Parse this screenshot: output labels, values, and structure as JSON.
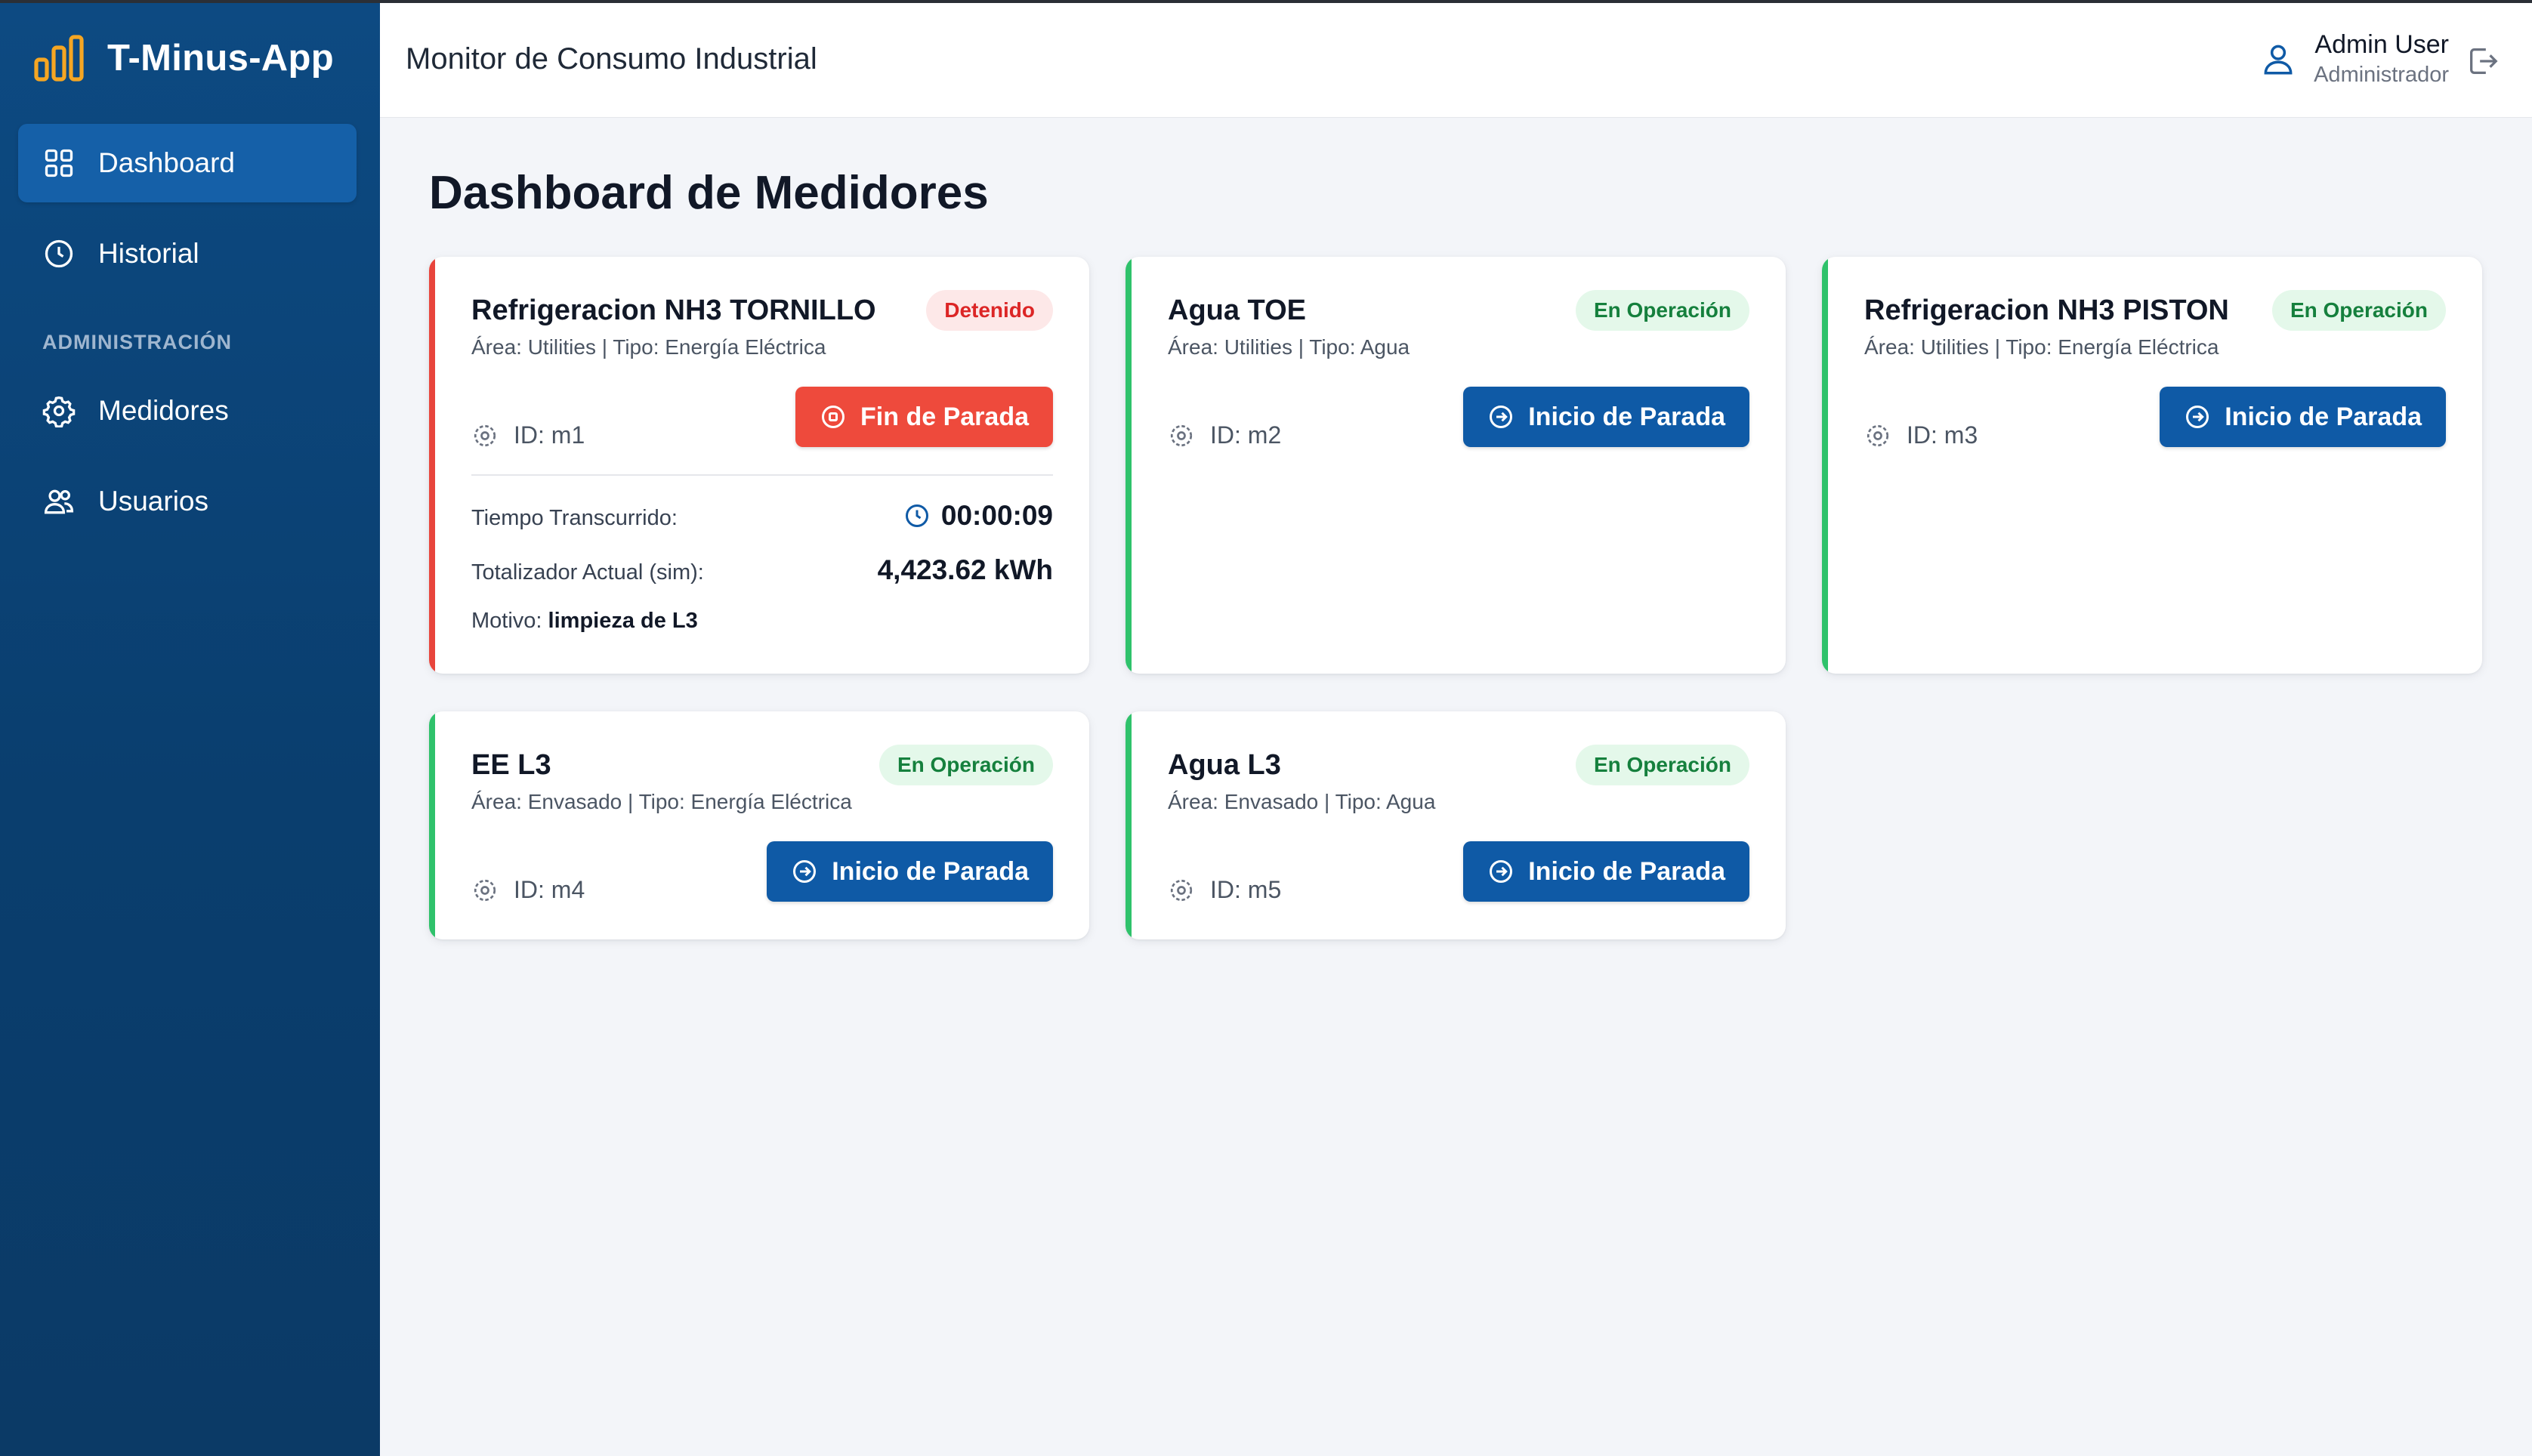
{
  "app": {
    "name": "T-Minus-App",
    "header_title": "Monitor de Consumo Industrial"
  },
  "colors": {
    "sidebar": "#0d4a82",
    "active": "#1560a8",
    "primary_button": "#0f5aa6",
    "stop_button": "#ee4a3c",
    "ok_green": "#2fc26b",
    "stop_red": "#e8453c",
    "logo": "#f5a623"
  },
  "sidebar": {
    "items": [
      {
        "label": "Dashboard",
        "icon": "grid-icon"
      },
      {
        "label": "Historial",
        "icon": "clock-icon"
      }
    ],
    "section_label": "ADMINISTRACIÓN",
    "admin_items": [
      {
        "label": "Medidores",
        "icon": "gear-icon"
      },
      {
        "label": "Usuarios",
        "icon": "users-icon"
      }
    ]
  },
  "user": {
    "name": "Admin User",
    "role": "Administrador"
  },
  "page_title": "Dashboard de Medidores",
  "meters": [
    {
      "title": "Refrigeracion NH3 TORNILLO",
      "subtitle": "Área: Utilities | Tipo: Energía Eléctrica",
      "status": "Detenido",
      "id": "ID: m1",
      "button": "Fin de Parada",
      "elapsed_label": "Tiempo Transcurrido:",
      "elapsed_value": "00:00:09",
      "total_label": "Totalizador Actual (sim):",
      "total_value": "4,423.62 kWh",
      "reason_label": "Motivo:",
      "reason_value": "limpieza de L3"
    },
    {
      "title": "Agua TOE",
      "subtitle": "Área: Utilities | Tipo: Agua",
      "status": "En Operación",
      "id": "ID: m2",
      "button": "Inicio de Parada"
    },
    {
      "title": "Refrigeracion NH3 PISTON",
      "subtitle": "Área: Utilities | Tipo: Energía Eléctrica",
      "status": "En Operación",
      "id": "ID: m3",
      "button": "Inicio de Parada"
    },
    {
      "title": "EE L3",
      "subtitle": "Área: Envasado | Tipo: Energía Eléctrica",
      "status": "En Operación",
      "id": "ID: m4",
      "button": "Inicio de Parada"
    },
    {
      "title": "Agua L3",
      "subtitle": "Área: Envasado | Tipo: Agua",
      "status": "En Operación",
      "id": "ID: m5",
      "button": "Inicio de Parada"
    }
  ]
}
